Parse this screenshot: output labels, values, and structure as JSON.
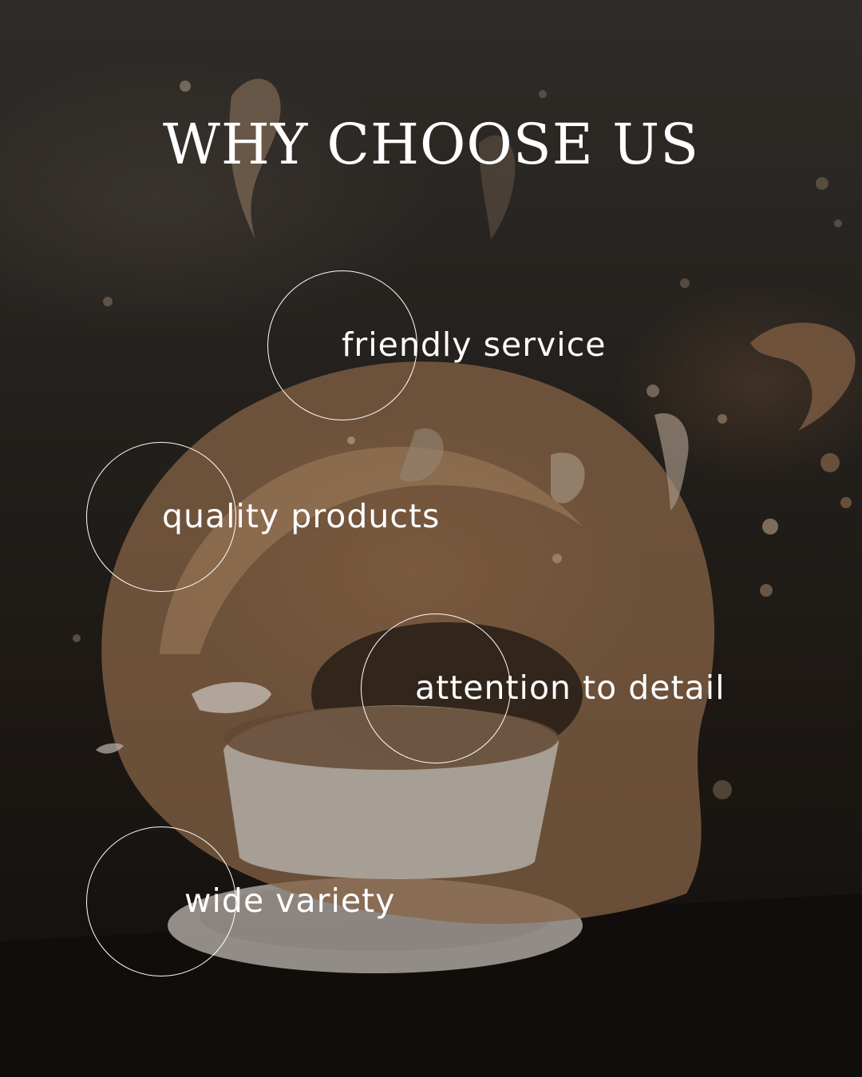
{
  "title": "WHY CHOOSE US",
  "features": [
    {
      "label": "friendly service"
    },
    {
      "label": "quality products"
    },
    {
      "label": "attention to detail"
    },
    {
      "label": "wide variety"
    }
  ],
  "colors": {
    "text": "#ffffff",
    "background": "#2c2824",
    "coffee": "#9c7250",
    "cream": "#d8c7b4"
  },
  "background_image": "coffee-splash"
}
